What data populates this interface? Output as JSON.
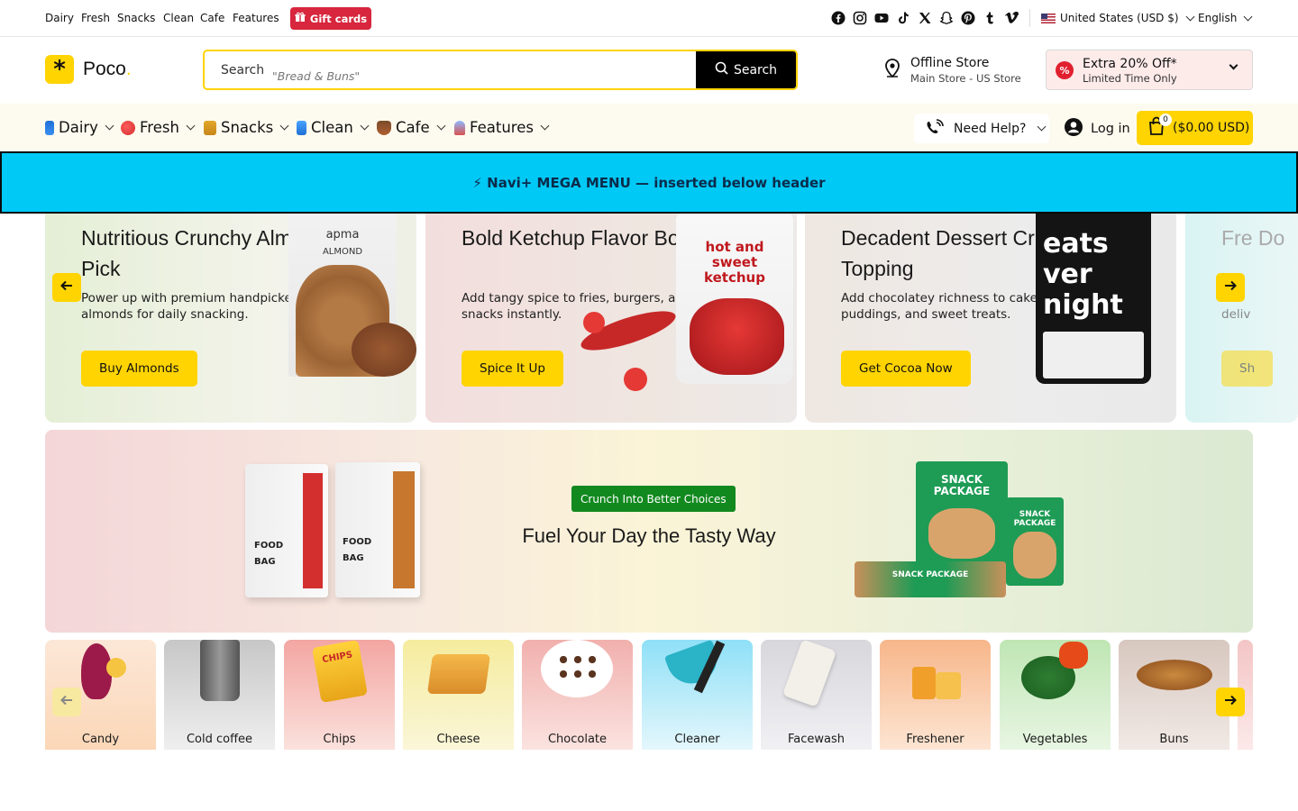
{
  "topbar": {
    "links": [
      "Dairy",
      "Fresh",
      "Snacks",
      "Clean",
      "Cafe",
      "Features"
    ],
    "gift_label": "Gift cards",
    "social_icons": [
      "facebook-icon",
      "instagram-icon",
      "youtube-icon",
      "tiktok-icon",
      "x-icon",
      "snapchat-icon",
      "pinterest-icon",
      "tumblr-icon",
      "vimeo-icon"
    ],
    "country": "United States (USD $)",
    "language": "English"
  },
  "header": {
    "logo": "Poco",
    "search_label": "Search",
    "search_placeholder": "\"Bread & Buns\"",
    "search_button": "Search",
    "store_title": "Offline Store",
    "store_subtitle": "Main Store - US Store",
    "promo_title": "Extra 20% Off*",
    "promo_subtitle": "Limited Time Only",
    "promo_badge": "%"
  },
  "nav": {
    "items": [
      "Dairy",
      "Fresh",
      "Snacks",
      "Clean",
      "Cafe",
      "Features"
    ],
    "help": "Need Help?",
    "login": "Log in",
    "cart_count": "0",
    "cart_total": "($0.00 USD)"
  },
  "mega_banner": "⚡ Navi+ MEGA MENU — inserted below header",
  "slides": [
    {
      "title": "Nutritious Crunchy Almond Pick",
      "desc": "Power up with premium handpicked almonds for daily snacking.",
      "button": "Buy Almonds",
      "brand": "apma",
      "product": "ALMOND"
    },
    {
      "title": "Bold Ketchup Flavor Boost",
      "desc": "Add tangy spice to fries, burgers, and snacks instantly.",
      "button": "Spice It Up",
      "product": "hot and sweet ketchup"
    },
    {
      "title": "Decadent Dessert Crumble Topping",
      "desc": "Add chocolatey richness to cakes, puddings, and sweet treats.",
      "button": "Get Cocoa Now",
      "product": "eats ver night"
    },
    {
      "title": "Fre Do",
      "desc": "deliv",
      "button": "Sh"
    }
  ],
  "banner": {
    "pill": "Crunch Into Better Choices",
    "title": "Fuel Your Day the Tasty Way",
    "bag_text": "FOOD BAG",
    "snack_text": "SNACK PACKAGE"
  },
  "categories": [
    "Candy",
    "Cold coffee",
    "Chips",
    "Cheese",
    "Chocolate",
    "Cleaner",
    "Facewash",
    "Freshener",
    "Vegetables",
    "Buns"
  ],
  "colors": {
    "accent": "#ffd400",
    "gift": "#d7263d",
    "mega": "#00c9f6",
    "pill": "#12891f"
  }
}
